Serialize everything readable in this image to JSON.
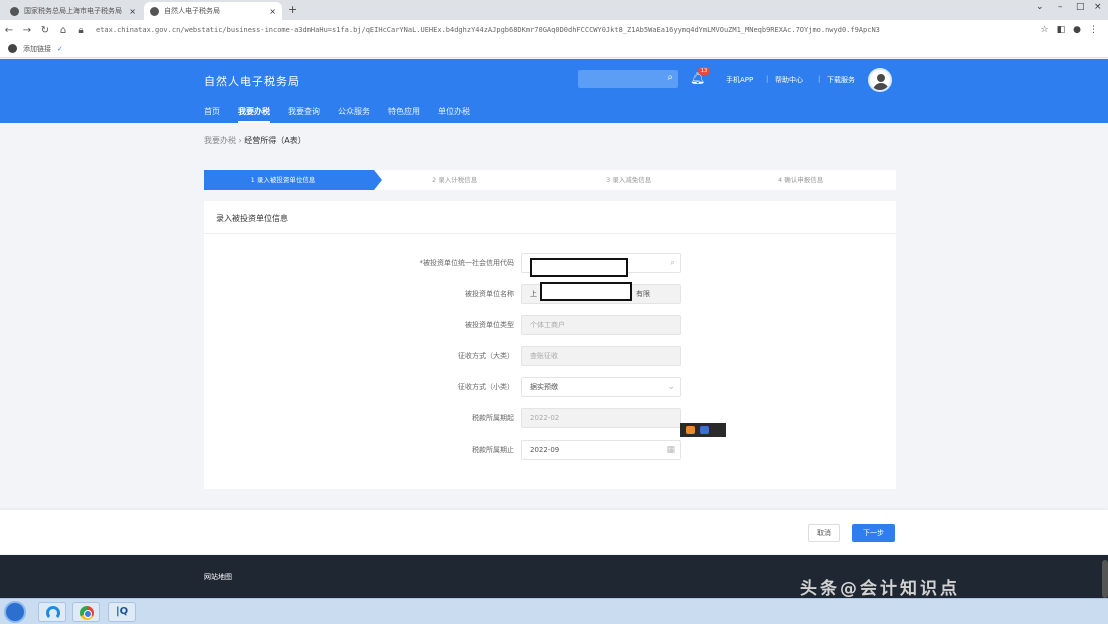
{
  "browser": {
    "tabs": [
      {
        "title": "国家税务总局上海市电子税务局",
        "active": false
      },
      {
        "title": "自然人电子税务局",
        "active": true
      }
    ],
    "url": "etax.chinatax.gov.cn/webstatic/business-income-a3dmHaHu=s1fa.bj/qEIHcCarYNaL.UEHEx.b4dghzY44zAJpgb68DKmr70GAq0D0dhFCCCWY0Jkt8_Z1Ab5WaEa16yymq4dYmLMVOuZM1_MNeqb9REXAc.7OYjmo.nwyd0.f9ApcN3",
    "bookmark": "添加链接"
  },
  "site": {
    "title": "自然人电子税务局",
    "links": [
      "手机APP",
      "帮助中心",
      "下载服务"
    ],
    "badge": "13",
    "nav": [
      "首页",
      "我要办税",
      "我要查询",
      "公众服务",
      "特色应用",
      "单位办税"
    ],
    "active_nav": 1
  },
  "breadcrumb": {
    "parent": "我要办税",
    "current": "经营所得（A表）"
  },
  "steps": [
    "1 录入被投资单位信息",
    "2 录入计税信息",
    "3 录入减免信息",
    "4 确认申报信息"
  ],
  "card_title": "录入被投资单位信息",
  "form": [
    {
      "label": "*被投资单位统一社会信用代码",
      "value": "",
      "placeholder": ""
    },
    {
      "label": "被投资单位名称",
      "value": "上",
      "suffix": "有限"
    },
    {
      "label": "被投资单位类型",
      "value": "个体工商户"
    },
    {
      "label": "征收方式（大类）",
      "value": "查账征收"
    },
    {
      "label": "征收方式（小类）",
      "value": "据实预缴"
    },
    {
      "label": "税款所属期起",
      "value": "2022-02"
    },
    {
      "label": "税款所属期止",
      "value": "2022-09"
    }
  ],
  "actions": {
    "cancel": "取消",
    "next": "下一步"
  },
  "footer": "网站地图",
  "watermark": "头条@会计知识点"
}
